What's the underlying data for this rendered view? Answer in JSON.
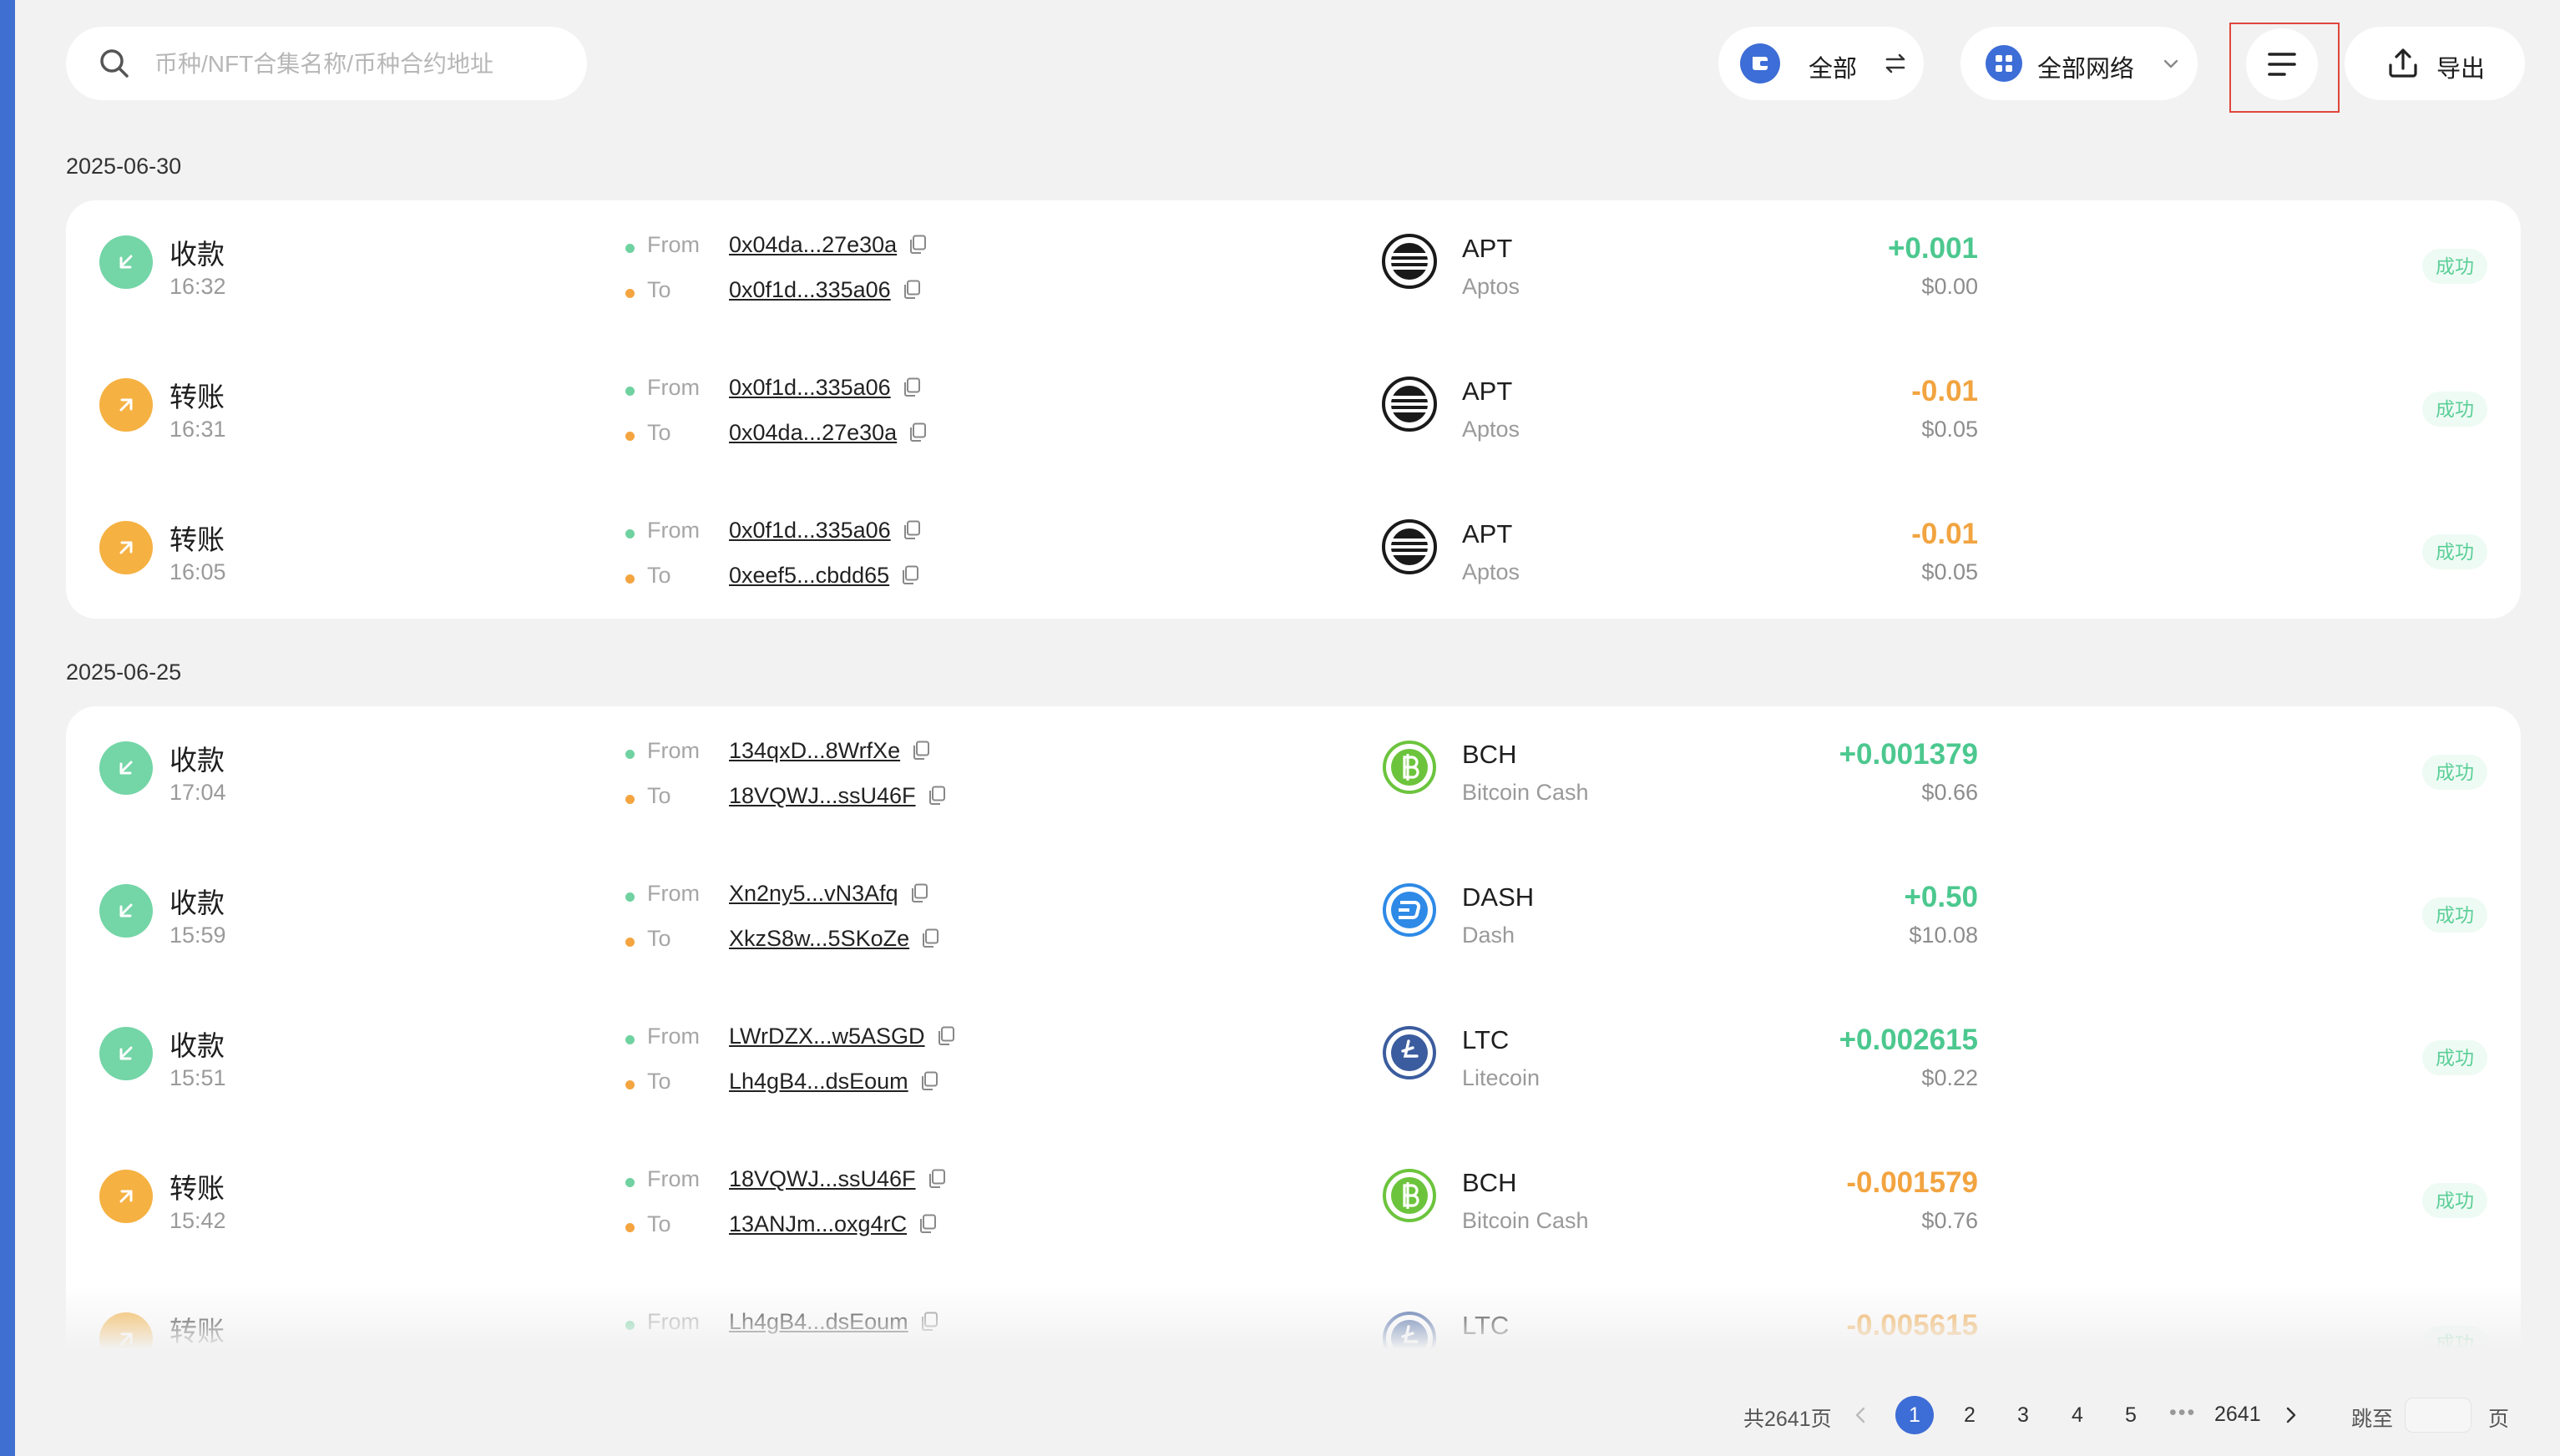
{
  "search": {
    "placeholder": "币种/NFT合集名称/币种合约地址",
    "icon": "search-icon"
  },
  "toolbar": {
    "wallet_label": "全部",
    "network_label": "全部网络",
    "export_label": "导出",
    "accent": "#3d6dd6"
  },
  "groups": [
    {
      "date": "2025-06-30",
      "rows": [
        {
          "direction": "in",
          "type": "收款",
          "time": "16:32",
          "from_key": "From",
          "from": "0x04da...27e30a",
          "to_key": "To",
          "to": "0x0f1d...335a06",
          "symbol": "APT",
          "coin": "Aptos",
          "coin_color": "#1a1a1a",
          "amount": "+0.001",
          "usd": "$0.00",
          "status": "成功"
        },
        {
          "direction": "out",
          "type": "转账",
          "time": "16:31",
          "from_key": "From",
          "from": "0x0f1d...335a06",
          "to_key": "To",
          "to": "0x04da...27e30a",
          "symbol": "APT",
          "coin": "Aptos",
          "coin_color": "#1a1a1a",
          "amount": "-0.01",
          "usd": "$0.05",
          "status": "成功"
        },
        {
          "direction": "out",
          "type": "转账",
          "time": "16:05",
          "from_key": "From",
          "from": "0x0f1d...335a06",
          "to_key": "To",
          "to": "0xeef5...cbdd65",
          "symbol": "APT",
          "coin": "Aptos",
          "coin_color": "#1a1a1a",
          "amount": "-0.01",
          "usd": "$0.05",
          "status": "成功"
        }
      ]
    },
    {
      "date": "2025-06-25",
      "rows": [
        {
          "direction": "in",
          "type": "收款",
          "time": "17:04",
          "from_key": "From",
          "from": "134qxD...8WrfXe",
          "to_key": "To",
          "to": "18VQWJ...ssU46F",
          "symbol": "BCH",
          "coin": "Bitcoin Cash",
          "coin_color": "#6cc43d",
          "amount": "+0.001379",
          "usd": "$0.66",
          "status": "成功"
        },
        {
          "direction": "in",
          "type": "收款",
          "time": "15:59",
          "from_key": "From",
          "from": "Xn2ny5...vN3Afq",
          "to_key": "To",
          "to": "XkzS8w...5SKoZe",
          "symbol": "DASH",
          "coin": "Dash",
          "coin_color": "#2e8ae6",
          "amount": "+0.50",
          "usd": "$10.08",
          "status": "成功"
        },
        {
          "direction": "in",
          "type": "收款",
          "time": "15:51",
          "from_key": "From",
          "from": "LWrDZX...w5ASGD",
          "to_key": "To",
          "to": "Lh4gB4...dsEoum",
          "symbol": "LTC",
          "coin": "Litecoin",
          "coin_color": "#3b5c9e",
          "amount": "+0.002615",
          "usd": "$0.22",
          "status": "成功"
        },
        {
          "direction": "out",
          "type": "转账",
          "time": "15:42",
          "from_key": "From",
          "from": "18VQWJ...ssU46F",
          "to_key": "To",
          "to": "13ANJm...oxg4rC",
          "symbol": "BCH",
          "coin": "Bitcoin Cash",
          "coin_color": "#6cc43d",
          "amount": "-0.001579",
          "usd": "$0.76",
          "status": "成功"
        },
        {
          "direction": "out",
          "type": "转账",
          "time": "",
          "from_key": "From",
          "from": "Lh4gB4...dsEoum",
          "to_key": "",
          "to": "",
          "symbol": "LTC",
          "coin": "",
          "coin_color": "#3b5c9e",
          "amount": "-0.005615",
          "usd": "",
          "status": "成功"
        }
      ]
    }
  ],
  "pagination": {
    "total_label": "共2641页",
    "pages": [
      "1",
      "2",
      "3",
      "4",
      "5"
    ],
    "current_page": "1",
    "ellipsis": "•••",
    "last_page": "2641",
    "jump_label": "跳至",
    "page_suffix": "页"
  }
}
